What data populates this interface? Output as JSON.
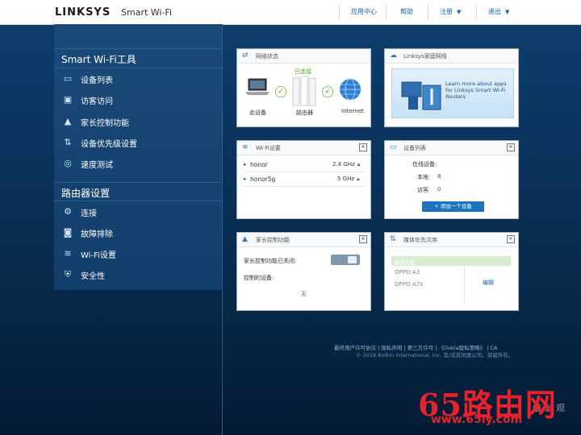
{
  "header": {
    "brand": "LINKSYS",
    "app_name": "Smart Wi-Fi",
    "nav": [
      "应用中心",
      "帮助",
      "注册",
      "退出"
    ]
  },
  "sidebar": {
    "section1_title": "Smart Wi-Fi工具",
    "tools": [
      {
        "label": "设备列表",
        "icon": "monitor-icon"
      },
      {
        "label": "访客访问",
        "icon": "guest-icon"
      },
      {
        "label": "家长控制功能",
        "icon": "warning-icon"
      },
      {
        "label": "设备优先级设置",
        "icon": "priority-icon"
      },
      {
        "label": "速度测试",
        "icon": "speed-icon"
      }
    ],
    "section2_title": "路由器设置",
    "settings": [
      {
        "label": "连接",
        "icon": "connection-icon"
      },
      {
        "label": "故障排除",
        "icon": "camera-icon"
      },
      {
        "label": "Wi-Fi设置",
        "icon": "wifi-icon"
      },
      {
        "label": "安全性",
        "icon": "shield-icon"
      }
    ]
  },
  "widgets": {
    "network": {
      "title": "网络状态",
      "connected": "已连接",
      "this_device": "此设备",
      "router": "路由器",
      "internet": "Internet"
    },
    "linksys_home": {
      "title": "Linksys家庭网络",
      "promo": "Learn more about apps for Linksys Smart Wi-Fi Routers"
    },
    "wifi": {
      "title": "Wi-Fi设置",
      "networks": [
        {
          "name": "honor",
          "band": "2.4 GHz"
        },
        {
          "name": "honor5g",
          "band": "5 GHz"
        }
      ]
    },
    "devices": {
      "title": "设备列表",
      "online_label": "在线设备:",
      "local_label": "本地",
      "local_count": "8",
      "guest_label": "访客",
      "guest_count": "0",
      "add_button": "添加一个设备"
    },
    "parental": {
      "title": "家长控制功能",
      "status": "家长控制功能已关闭:",
      "controlled_label": "控制的设备:",
      "none": "无"
    },
    "media": {
      "title": "媒体优先次序",
      "header": "高优先级",
      "devices": [
        "OPPO-A3",
        "OPPO-A7x"
      ],
      "edit": "编辑"
    }
  },
  "footer": {
    "links": "最终用户许可协议 | 隐私声明 | 第三方许可 | 《Ookla隐私策略》 | CA",
    "copyright": "© 2018 Belkin International, Inc. 及/或其附属公司。保留所有。"
  },
  "watermark": {
    "text": "65路由网",
    "url": "www.65ly.com",
    "side": "值 么 观"
  },
  "colors": {
    "accent": "#1e73be",
    "background": "#0b3560",
    "check": "#56a22b",
    "watermark": "#e8212a"
  }
}
